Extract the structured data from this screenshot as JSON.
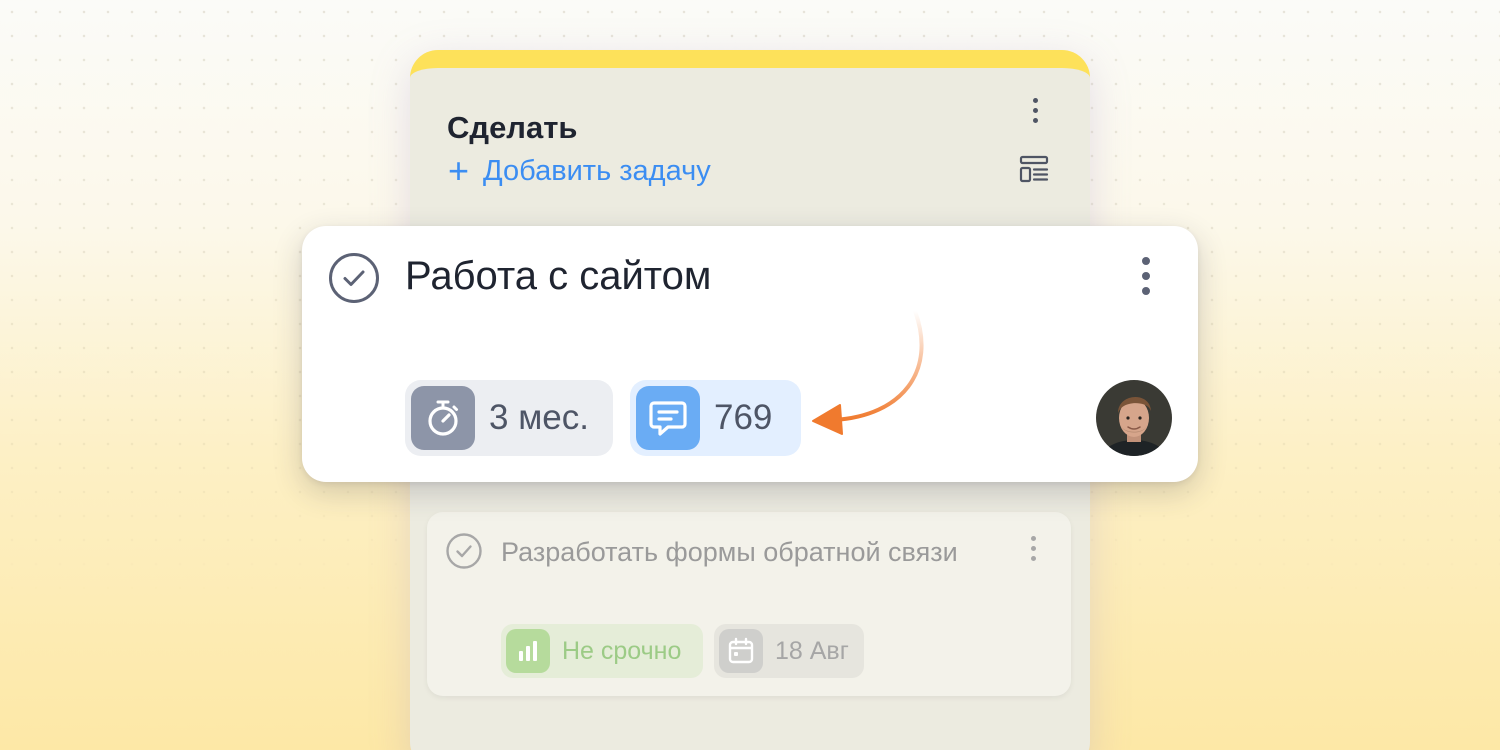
{
  "column": {
    "title": "Сделать",
    "add_task_label": "Добавить задачу",
    "accent_color": "#fde15a"
  },
  "main_task": {
    "title": "Работа с сайтом",
    "duration": "3 мес.",
    "comments_count": "769",
    "icons": {
      "check": "check-circle-icon",
      "duration": "stopwatch-icon",
      "comments": "chat-bubble-icon",
      "menu": "kebab-menu-icon",
      "assignee": "avatar"
    }
  },
  "secondary_task": {
    "title": "Разработать формы обратной связи",
    "priority_label": "Не срочно",
    "due_date": "18 Авг",
    "icons": {
      "check": "check-circle-icon",
      "priority": "bar-chart-icon",
      "date": "calendar-icon",
      "menu": "kebab-menu-icon"
    }
  },
  "colors": {
    "link_blue": "#3b8df2",
    "arrow_orange": "#f07a2e",
    "priority_green": "#9ccb86"
  }
}
